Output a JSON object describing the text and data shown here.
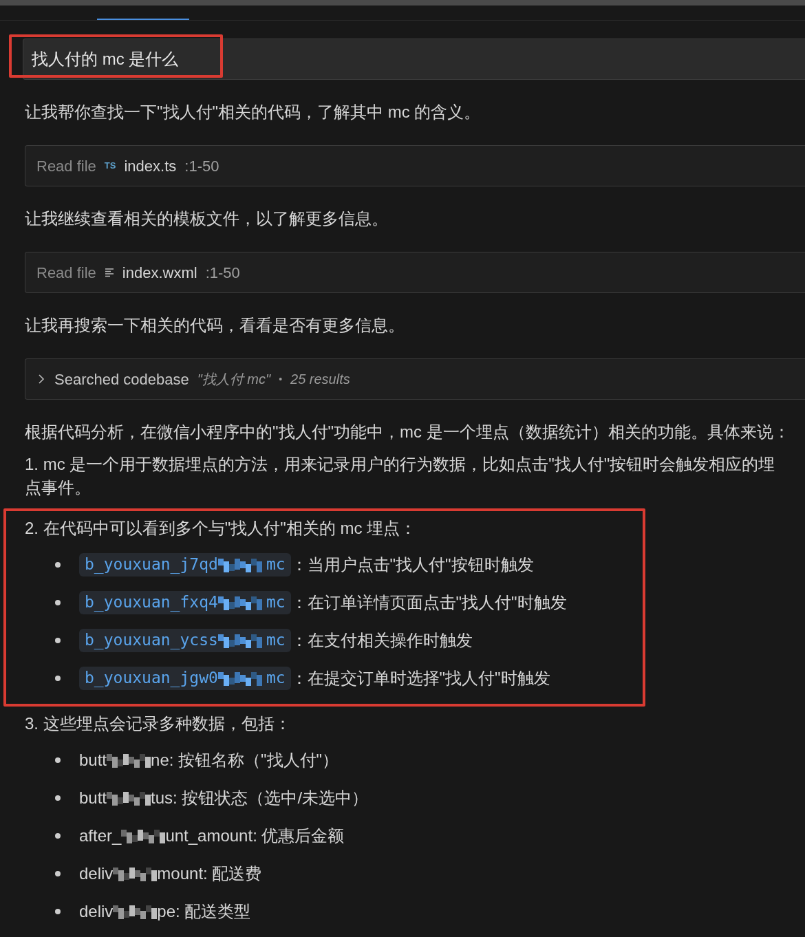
{
  "question": {
    "text": "找人付的 mc 是什么",
    "highlighted": true
  },
  "messages": [
    {
      "kind": "text",
      "text": "让我帮你查找一下\"找人付\"相关的代码，了解其中 mc 的含义。"
    },
    {
      "kind": "tool",
      "action": "Read file",
      "icon": {
        "kind": "badge",
        "text": "TS"
      },
      "file": "index.ts",
      "range": ":1-50"
    },
    {
      "kind": "text",
      "text": "让我继续查看相关的模板文件，以了解更多信息。"
    },
    {
      "kind": "tool",
      "action": "Read file",
      "icon": {
        "kind": "lines"
      },
      "file": "index.wxml",
      "range": ":1-50"
    },
    {
      "kind": "text",
      "text": "让我再搜索一下相关的代码，看看是否有更多信息。"
    },
    {
      "kind": "search",
      "expanded": false,
      "label": "Searched codebase",
      "query": "\"找人付 mc\"",
      "separator": "•",
      "count": "25 results"
    },
    {
      "kind": "text",
      "text": "根据代码分析，在微信小程序中的\"找人付\"功能中，mc 是一个埋点（数据统计）相关的功能。具体来说："
    },
    {
      "kind": "text",
      "text": "1. mc 是一个用于数据埋点的方法，用来记录用户的行为数据，比如点击\"找人付\"按钮时会触发相应的埋点事件。"
    },
    {
      "kind": "code_list",
      "highlighted": true,
      "text": "2. 在代码中可以看到多个与\"找人付\"相关的 mc 埋点：",
      "items": [
        {
          "code_start": "b_youxuan_j7qd",
          "code_end": "mc",
          "description": "：当用户点击\"找人付\"按钮时触发"
        },
        {
          "code_start": "b_youxuan_fxq4",
          "code_end": "mc",
          "description": "：在订单详情页面点击\"找人付\"时触发"
        },
        {
          "code_start": "b_youxuan_ycss",
          "code_end": "mc",
          "description": "：在支付相关操作时触发"
        },
        {
          "code_start": "b_youxuan_jgw0",
          "code_end": "mc",
          "description": "：在提交订单时选择\"找人付\"时触发"
        }
      ]
    },
    {
      "kind": "field_list",
      "text": "3. 这些埋点会记录多种数据，包括：",
      "items": [
        {
          "before": "butt",
          "after": "ne: 按钮名称（\"找人付\"）"
        },
        {
          "before": "butt",
          "after": "tus: 按钮状态（选中/未选中）"
        },
        {
          "before": "after_",
          "after": "unt_amount: 优惠后金额"
        },
        {
          "before": "deliv",
          "after": "mount: 配送费"
        },
        {
          "before": "deliv",
          "after": "pe: 配送类型"
        }
      ]
    }
  ]
}
